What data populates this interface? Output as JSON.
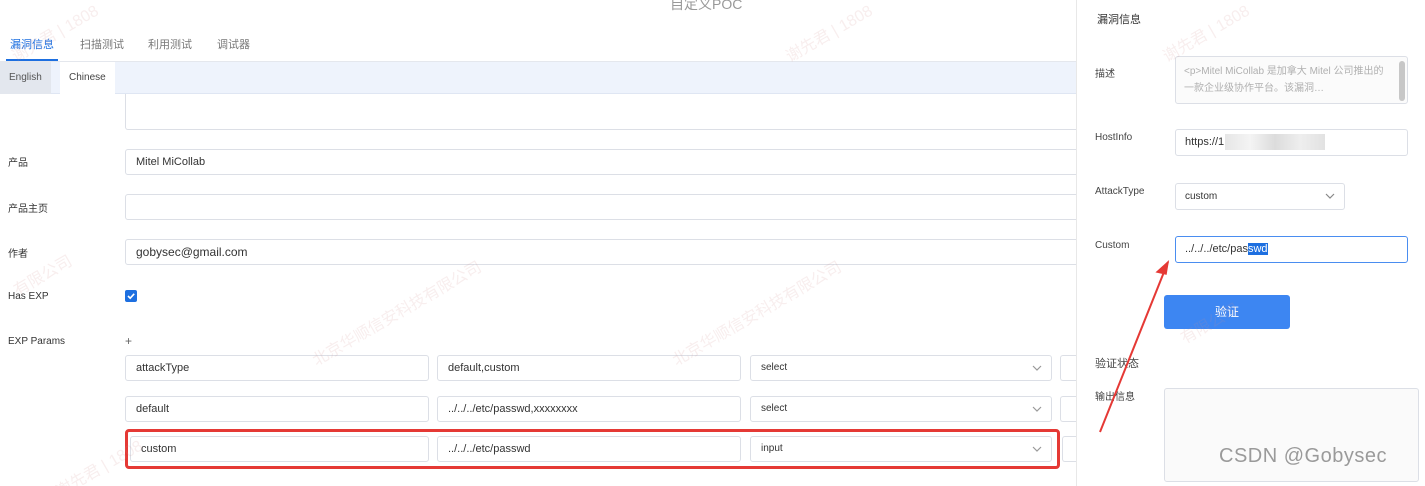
{
  "window": {
    "title": "自定义POC"
  },
  "tabs": [
    {
      "label": "漏洞信息"
    },
    {
      "label": "扫描测试"
    },
    {
      "label": "利用测试"
    },
    {
      "label": "调试器"
    }
  ],
  "lang_tabs": [
    {
      "label": "English"
    },
    {
      "label": "Chinese"
    }
  ],
  "form": {
    "product_label": "产品",
    "product_value": "Mitel MiCollab",
    "homepage_label": "产品主页",
    "homepage_value": "",
    "author_label": "作者",
    "author_value": "gobysec@gmail.com",
    "has_exp_label": "Has EXP",
    "has_exp_checked": true,
    "exp_params_label": "EXP Params",
    "add_symbol": "+"
  },
  "exp_params": [
    {
      "name": "attackType",
      "value": "default,custom",
      "type": "select"
    },
    {
      "name": "default",
      "value": "../../../etc/passwd,xxxxxxxx",
      "type": "select"
    },
    {
      "name": "custom",
      "value": "../../../etc/passwd",
      "type": "input"
    }
  ],
  "panel": {
    "title": "漏洞信息",
    "desc_label": "描述",
    "desc_value": "<p>Mitel MiCollab 是加拿大 Mitel 公司推出的一款企业级协作平台。该漏洞…",
    "hostinfo_label": "HostInfo",
    "hostinfo_value": "https://1",
    "attacktype_label": "AttackType",
    "attacktype_value": "custom",
    "custom_label": "Custom",
    "custom_value_plain": "../../../etc/pas",
    "custom_value_selected": "swd",
    "verify_button": "验证",
    "status_label": "验证状态",
    "output_label": "输出信息"
  },
  "watermark": {
    "name": "谢先君 | 1808",
    "company": "北京华顺信安科技有限公司",
    "company_short": "有限公司"
  },
  "csdn_mark": "CSDN @Gobysec",
  "colors": {
    "accent": "#1d6fe0",
    "highlight_box": "#e53935",
    "button": "#3d86f2"
  }
}
